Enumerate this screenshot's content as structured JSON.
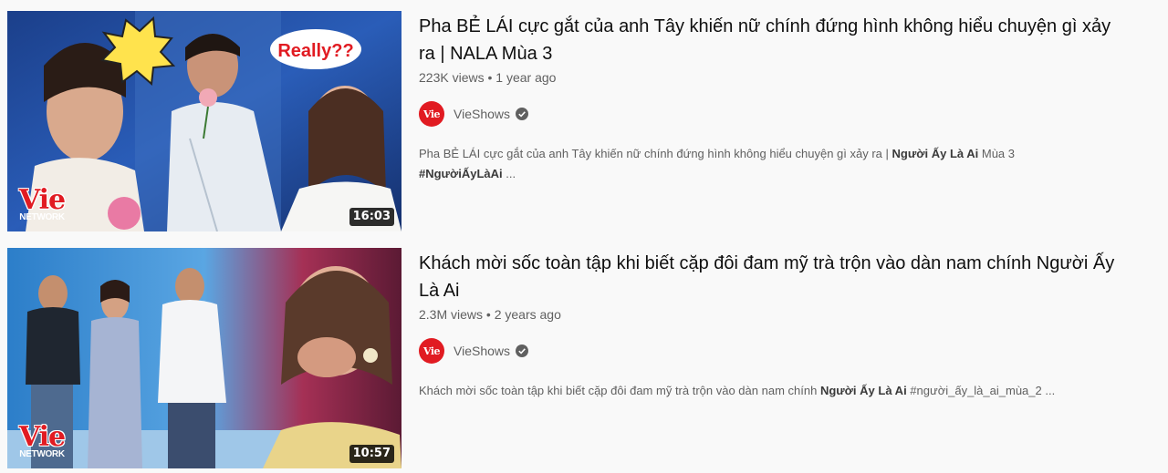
{
  "results": [
    {
      "title": "Pha BẺ LÁI cực gắt của anh Tây khiến nữ chính đứng hình không hiểu chuyện gì xảy ra | NALA Mùa 3",
      "views": "223K views",
      "age": "1 year ago",
      "channel": "VieShows",
      "desc_pre": "Pha BẺ LÁI cực gắt của anh Tây khiến nữ chính đứng hình không hiểu chuyện gì xảy ra | ",
      "desc_bold": "Người Ấy Là Ai",
      "desc_mid": " Mùa 3",
      "desc_bold2": "#NgườiẤyLàAi",
      "desc_post": " ...",
      "duration": "16:03",
      "sticker_text": "Really??"
    },
    {
      "title": "Khách mời sốc toàn tập khi biết cặp đôi đam mỹ trà trộn vào dàn nam chính Người Ấy Là Ai",
      "views": "2.3M views",
      "age": "2 years ago",
      "channel": "VieShows",
      "desc_pre": "Khách mời sốc toàn tập khi biết cặp đôi đam mỹ trà trộn vào dàn nam chính ",
      "desc_bold": "Người Ấy Là Ai",
      "desc_post": " #người_ấy_là_ai_mùa_2 ...",
      "duration": "10:57"
    }
  ],
  "brand": {
    "logo_text": "Vie",
    "network_text": "NETWORK",
    "avatar_text": "Vie"
  },
  "separator": "•",
  "colors": {
    "background": "#f9f9f9",
    "brand_red": "#e11b22",
    "meta_gray": "#606060"
  },
  "icons": {
    "verified": "verified-check-icon"
  }
}
